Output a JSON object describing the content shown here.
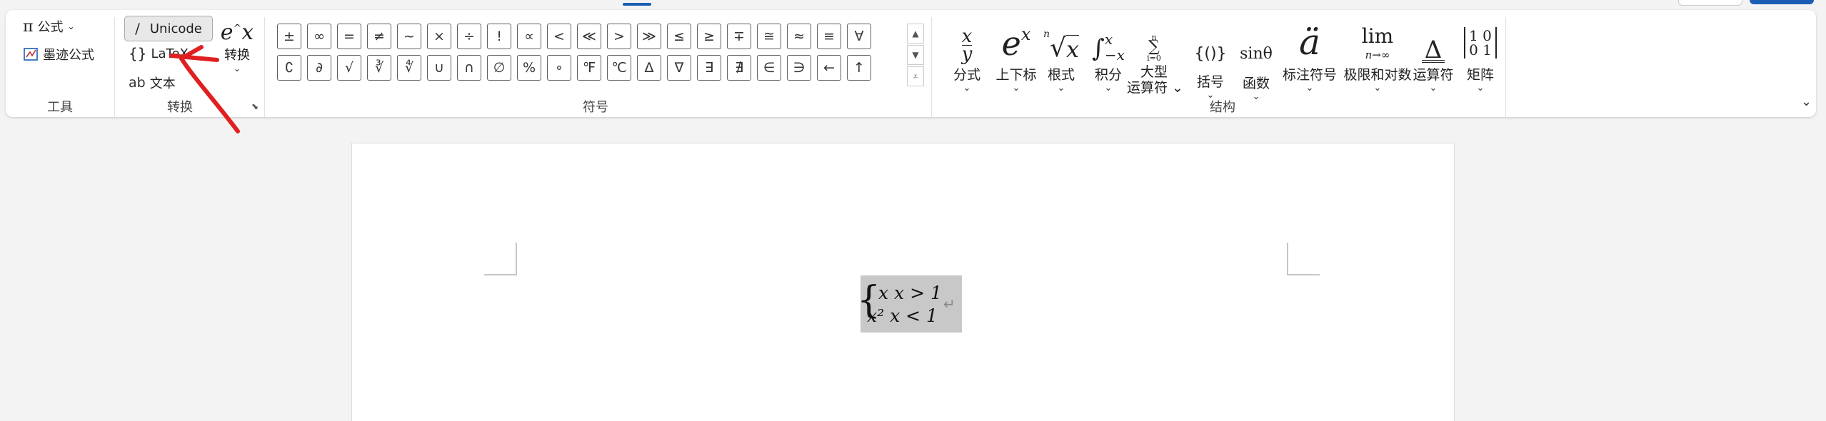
{
  "ribbon": {
    "tools": {
      "equation_label": "公式",
      "ink_equation_label": "墨迹公式",
      "group_label": "工具"
    },
    "conversions": {
      "unicode_label": "Unicode",
      "latex_label": "LaTeX",
      "text_label": "文本",
      "convert_label": "转换",
      "group_label": "转换"
    },
    "symbols": {
      "group_label": "符号",
      "row1": [
        "±",
        "∞",
        "=",
        "≠",
        "~",
        "×",
        "÷",
        "!",
        "∝",
        "<",
        "≪",
        ">",
        "≫",
        "≤",
        "≥",
        "∓",
        "≅",
        "≈",
        "≡",
        "∀"
      ],
      "row2": [
        "∁",
        "∂",
        "√",
        "∛",
        "∜",
        "∪",
        "∩",
        "∅",
        "%",
        "∘",
        "℉",
        "℃",
        "∆",
        "∇",
        "∃",
        "∄",
        "∈",
        "∋",
        "←",
        "↑"
      ]
    },
    "structures": {
      "group_label": "结构",
      "items": [
        {
          "label": "分式",
          "icon": "fraction-icon"
        },
        {
          "label": "上下标",
          "icon": "script-icon"
        },
        {
          "label": "根式",
          "icon": "radical-icon"
        },
        {
          "label": "积分",
          "icon": "integral-icon"
        },
        {
          "label": "大型",
          "label2": "运算符",
          "icon": "large-operator-icon"
        },
        {
          "label": "括号",
          "icon": "bracket-icon"
        },
        {
          "label": "函数",
          "icon": "function-icon"
        },
        {
          "label": "标注符号",
          "icon": "accent-icon"
        },
        {
          "label": "极限和对数",
          "icon": "limit-log-icon"
        },
        {
          "label": "运算符",
          "icon": "operator-icon"
        },
        {
          "label": "矩阵",
          "icon": "matrix-icon"
        }
      ]
    }
  },
  "document": {
    "equation": {
      "line1": "x  x > 1",
      "line2": "x²  x < 1"
    },
    "paragraph_mark": "↵"
  },
  "colors": {
    "accent": "#1a5fb4",
    "annotation_arrow": "#e02020",
    "equation_highlight": "#c8c8c8"
  }
}
